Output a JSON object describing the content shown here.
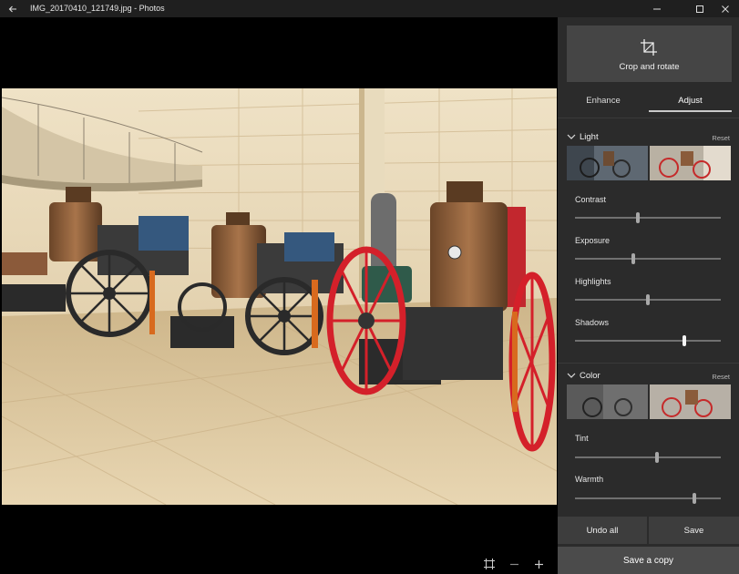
{
  "window": {
    "title": "IMG_20170410_121749.jpg - Photos",
    "back_icon": "back-arrow-icon",
    "minimize_icon": "minimize-icon",
    "maximize_icon": "maximize-icon",
    "close_icon": "close-icon"
  },
  "canvas": {
    "zoom_controls": [
      {
        "name": "fit-to-window-icon"
      },
      {
        "name": "zoom-out-icon"
      },
      {
        "name": "zoom-in-icon"
      }
    ]
  },
  "panel": {
    "crop": {
      "label": "Crop and rotate",
      "icon": "crop-icon"
    },
    "tabs": [
      {
        "label": "Enhance",
        "selected": false
      },
      {
        "label": "Adjust",
        "selected": true
      }
    ],
    "light": {
      "title": "Light",
      "reset": "Reset",
      "sliders": [
        {
          "label": "Contrast",
          "value": 0.43
        },
        {
          "label": "Exposure",
          "value": 0.4
        },
        {
          "label": "Highlights",
          "value": 0.5
        },
        {
          "label": "Shadows",
          "value": 0.75
        }
      ]
    },
    "color": {
      "title": "Color",
      "reset": "Reset",
      "sliders": [
        {
          "label": "Tint",
          "value": 0.56
        },
        {
          "label": "Warmth",
          "value": 0.82
        }
      ]
    },
    "actions": {
      "undo_all": "Undo all",
      "save": "Save",
      "save_copy": "Save a copy"
    }
  },
  "colors": {
    "panel_bg": "#2b2b2b",
    "titlebar_bg": "#1f1f1f",
    "wheel_red": "#d4202a"
  }
}
